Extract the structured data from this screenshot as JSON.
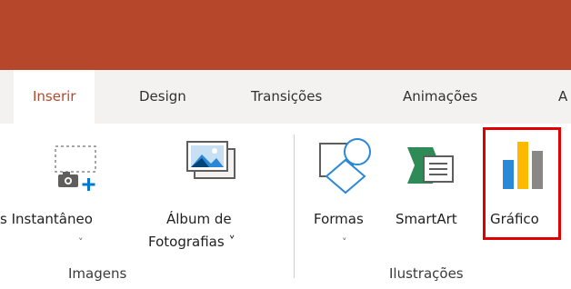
{
  "tabs": [
    {
      "label": "Inserir",
      "active": true
    },
    {
      "label": "Design"
    },
    {
      "label": "Transições"
    },
    {
      "label": "Animações"
    },
    {
      "label": "A"
    }
  ],
  "commands": {
    "instantaneo": {
      "label": "s Instantâneo",
      "chevron": "˅"
    },
    "album": {
      "label_line1": "Álbum de",
      "label_line2": "Fotografias ˅"
    },
    "formas": {
      "label": "Formas",
      "chevron": "˅"
    },
    "smartart": {
      "label": "SmartArt"
    },
    "grafico": {
      "label": "Gráfico",
      "highlighted": true
    }
  },
  "groups": {
    "imagens": "Imagens",
    "ilustracoes": "Ilustrações"
  },
  "colors": {
    "brand": "#b7472a",
    "highlight": "#e00000"
  },
  "icons": [
    "camera-icon",
    "photo-album-icon",
    "shapes-icon",
    "smartart-icon",
    "chart-icon"
  ]
}
